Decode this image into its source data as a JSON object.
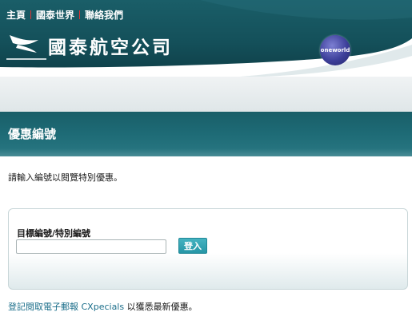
{
  "top_nav": {
    "home": "主頁",
    "cathay_world": "國泰世界",
    "contact_us": "聯絡我們"
  },
  "brand": {
    "name": "國泰航空公司",
    "alliance": "oneworld"
  },
  "page": {
    "title": "優惠編號",
    "intro": "請輸入編號以閱覽特別優惠。"
  },
  "form": {
    "label": "目標編號/特別編號",
    "input_value": "",
    "submit_label": "登入"
  },
  "footer": {
    "signup_link": "登記閱取電子郵報 CXpecials",
    "suffix": "以獲悉最新優惠。"
  },
  "colors": {
    "header_teal": "#14505a",
    "button_teal": "#2696a6",
    "link": "#1b6e8a"
  }
}
